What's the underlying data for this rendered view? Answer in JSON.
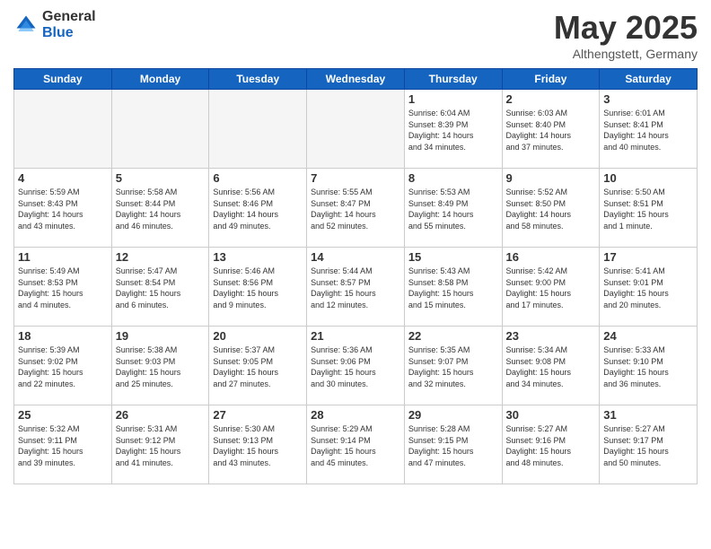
{
  "header": {
    "logo_general": "General",
    "logo_blue": "Blue",
    "title": "May 2025",
    "subtitle": "Althengstett, Germany"
  },
  "days_of_week": [
    "Sunday",
    "Monday",
    "Tuesday",
    "Wednesday",
    "Thursday",
    "Friday",
    "Saturday"
  ],
  "weeks": [
    [
      {
        "num": "",
        "info": ""
      },
      {
        "num": "",
        "info": ""
      },
      {
        "num": "",
        "info": ""
      },
      {
        "num": "",
        "info": ""
      },
      {
        "num": "1",
        "info": "Sunrise: 6:04 AM\nSunset: 8:39 PM\nDaylight: 14 hours\nand 34 minutes."
      },
      {
        "num": "2",
        "info": "Sunrise: 6:03 AM\nSunset: 8:40 PM\nDaylight: 14 hours\nand 37 minutes."
      },
      {
        "num": "3",
        "info": "Sunrise: 6:01 AM\nSunset: 8:41 PM\nDaylight: 14 hours\nand 40 minutes."
      }
    ],
    [
      {
        "num": "4",
        "info": "Sunrise: 5:59 AM\nSunset: 8:43 PM\nDaylight: 14 hours\nand 43 minutes."
      },
      {
        "num": "5",
        "info": "Sunrise: 5:58 AM\nSunset: 8:44 PM\nDaylight: 14 hours\nand 46 minutes."
      },
      {
        "num": "6",
        "info": "Sunrise: 5:56 AM\nSunset: 8:46 PM\nDaylight: 14 hours\nand 49 minutes."
      },
      {
        "num": "7",
        "info": "Sunrise: 5:55 AM\nSunset: 8:47 PM\nDaylight: 14 hours\nand 52 minutes."
      },
      {
        "num": "8",
        "info": "Sunrise: 5:53 AM\nSunset: 8:49 PM\nDaylight: 14 hours\nand 55 minutes."
      },
      {
        "num": "9",
        "info": "Sunrise: 5:52 AM\nSunset: 8:50 PM\nDaylight: 14 hours\nand 58 minutes."
      },
      {
        "num": "10",
        "info": "Sunrise: 5:50 AM\nSunset: 8:51 PM\nDaylight: 15 hours\nand 1 minute."
      }
    ],
    [
      {
        "num": "11",
        "info": "Sunrise: 5:49 AM\nSunset: 8:53 PM\nDaylight: 15 hours\nand 4 minutes."
      },
      {
        "num": "12",
        "info": "Sunrise: 5:47 AM\nSunset: 8:54 PM\nDaylight: 15 hours\nand 6 minutes."
      },
      {
        "num": "13",
        "info": "Sunrise: 5:46 AM\nSunset: 8:56 PM\nDaylight: 15 hours\nand 9 minutes."
      },
      {
        "num": "14",
        "info": "Sunrise: 5:44 AM\nSunset: 8:57 PM\nDaylight: 15 hours\nand 12 minutes."
      },
      {
        "num": "15",
        "info": "Sunrise: 5:43 AM\nSunset: 8:58 PM\nDaylight: 15 hours\nand 15 minutes."
      },
      {
        "num": "16",
        "info": "Sunrise: 5:42 AM\nSunset: 9:00 PM\nDaylight: 15 hours\nand 17 minutes."
      },
      {
        "num": "17",
        "info": "Sunrise: 5:41 AM\nSunset: 9:01 PM\nDaylight: 15 hours\nand 20 minutes."
      }
    ],
    [
      {
        "num": "18",
        "info": "Sunrise: 5:39 AM\nSunset: 9:02 PM\nDaylight: 15 hours\nand 22 minutes."
      },
      {
        "num": "19",
        "info": "Sunrise: 5:38 AM\nSunset: 9:03 PM\nDaylight: 15 hours\nand 25 minutes."
      },
      {
        "num": "20",
        "info": "Sunrise: 5:37 AM\nSunset: 9:05 PM\nDaylight: 15 hours\nand 27 minutes."
      },
      {
        "num": "21",
        "info": "Sunrise: 5:36 AM\nSunset: 9:06 PM\nDaylight: 15 hours\nand 30 minutes."
      },
      {
        "num": "22",
        "info": "Sunrise: 5:35 AM\nSunset: 9:07 PM\nDaylight: 15 hours\nand 32 minutes."
      },
      {
        "num": "23",
        "info": "Sunrise: 5:34 AM\nSunset: 9:08 PM\nDaylight: 15 hours\nand 34 minutes."
      },
      {
        "num": "24",
        "info": "Sunrise: 5:33 AM\nSunset: 9:10 PM\nDaylight: 15 hours\nand 36 minutes."
      }
    ],
    [
      {
        "num": "25",
        "info": "Sunrise: 5:32 AM\nSunset: 9:11 PM\nDaylight: 15 hours\nand 39 minutes."
      },
      {
        "num": "26",
        "info": "Sunrise: 5:31 AM\nSunset: 9:12 PM\nDaylight: 15 hours\nand 41 minutes."
      },
      {
        "num": "27",
        "info": "Sunrise: 5:30 AM\nSunset: 9:13 PM\nDaylight: 15 hours\nand 43 minutes."
      },
      {
        "num": "28",
        "info": "Sunrise: 5:29 AM\nSunset: 9:14 PM\nDaylight: 15 hours\nand 45 minutes."
      },
      {
        "num": "29",
        "info": "Sunrise: 5:28 AM\nSunset: 9:15 PM\nDaylight: 15 hours\nand 47 minutes."
      },
      {
        "num": "30",
        "info": "Sunrise: 5:27 AM\nSunset: 9:16 PM\nDaylight: 15 hours\nand 48 minutes."
      },
      {
        "num": "31",
        "info": "Sunrise: 5:27 AM\nSunset: 9:17 PM\nDaylight: 15 hours\nand 50 minutes."
      }
    ]
  ]
}
